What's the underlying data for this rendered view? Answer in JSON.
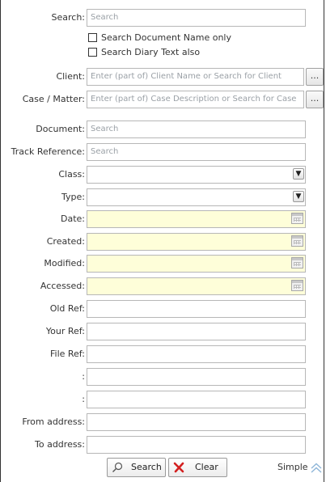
{
  "search": {
    "label": "Search:",
    "placeholder": "Search"
  },
  "options": [
    {
      "label": "Search Document Name only",
      "checked": false
    },
    {
      "label": "Search Diary Text also",
      "checked": false
    }
  ],
  "client": {
    "label": "Client:",
    "placeholder": "Enter (part of) Client Name or Search for Client",
    "browse": "..."
  },
  "case": {
    "label": "Case / Matter:",
    "placeholder": "Enter (part of) Case Description or Search for Case",
    "browse": "..."
  },
  "document": {
    "label": "Document:",
    "placeholder": "Search"
  },
  "track": {
    "label": "Track Reference:",
    "placeholder": "Search"
  },
  "class": {
    "label": "Class:",
    "value": ""
  },
  "type": {
    "label": "Type:",
    "value": ""
  },
  "dates": {
    "date": "Date:",
    "created": "Created:",
    "modified": "Modified:",
    "accessed": "Accessed:"
  },
  "refs": {
    "old": "Old Ref:",
    "your": "Your Ref:",
    "file": "File Ref:"
  },
  "custom1": {
    "label": ":"
  },
  "custom2": {
    "label": ":"
  },
  "from": {
    "label": "From address:"
  },
  "to": {
    "label": "To address:"
  },
  "buttons": {
    "search": "Search",
    "clear": "Clear"
  },
  "mode": {
    "label": "Simple"
  },
  "colors": {
    "date_field_bg": "#fefed9",
    "clear_icon": "#d32020"
  }
}
